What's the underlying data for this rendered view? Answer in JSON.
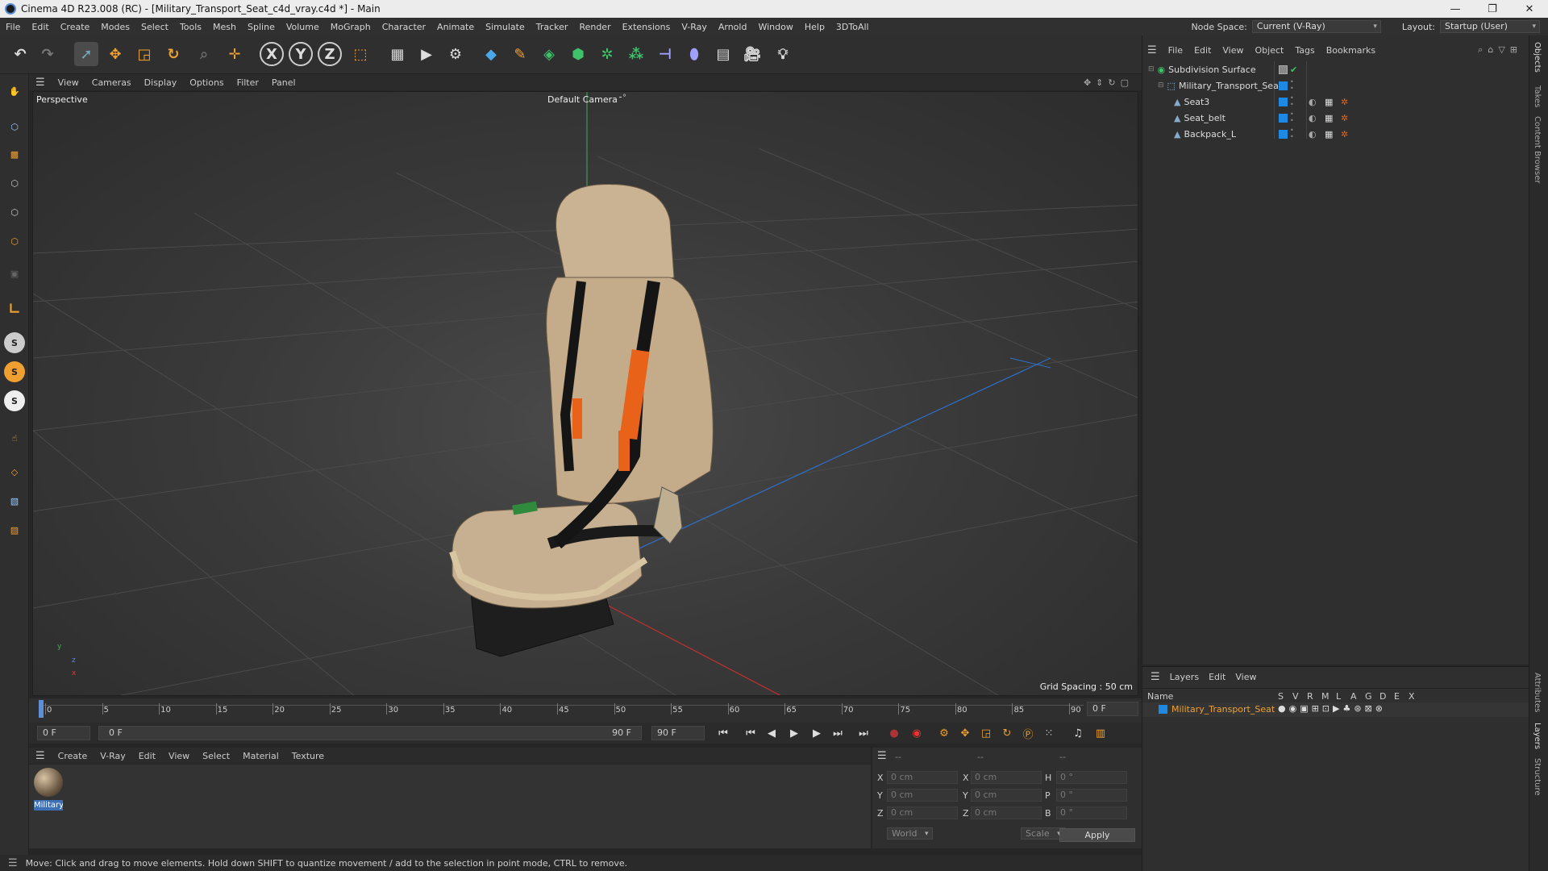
{
  "window": {
    "title": "Cinema 4D R23.008 (RC) - [Military_Transport_Seat_c4d_vray.c4d *] - Main",
    "min": "—",
    "max": "❐",
    "close": "✕"
  },
  "menu": [
    "File",
    "Edit",
    "Create",
    "Modes",
    "Select",
    "Tools",
    "Mesh",
    "Spline",
    "Volume",
    "MoGraph",
    "Character",
    "Animate",
    "Simulate",
    "Tracker",
    "Render",
    "Extensions",
    "V-Ray",
    "Arnold",
    "Window",
    "Help",
    "3DToAll"
  ],
  "node_space": {
    "label": "Node Space:",
    "value": "Current (V-Ray)"
  },
  "layout": {
    "label": "Layout:",
    "value": "Startup (User)"
  },
  "viewport": {
    "menu": [
      "View",
      "Cameras",
      "Display",
      "Options",
      "Filter",
      "Panel"
    ],
    "name": "Perspective",
    "camera": "Default Camera",
    "grid_spacing": "Grid Spacing : 50 cm",
    "axis": {
      "y": "y",
      "z": "z",
      "x": "x"
    }
  },
  "timeline": {
    "ticks": [
      "0",
      "5",
      "10",
      "15",
      "20",
      "25",
      "30",
      "35",
      "40",
      "45",
      "50",
      "55",
      "60",
      "65",
      "70",
      "75",
      "80",
      "85",
      "90"
    ],
    "current_frame": "0 F",
    "start": "0 F",
    "range_start": "0 F",
    "range_end": "90 F",
    "end": "90 F"
  },
  "material_manager": {
    "menu": [
      "Create",
      "V-Ray",
      "Edit",
      "View",
      "Select",
      "Material",
      "Texture"
    ],
    "materials": [
      {
        "name": "Military"
      }
    ]
  },
  "coordinates": {
    "header": [
      "--",
      "--",
      "--"
    ],
    "rows": [
      {
        "a": "X",
        "av": "0 cm",
        "b": "X",
        "bv": "0 cm",
        "c": "H",
        "cv": "0 °"
      },
      {
        "a": "Y",
        "av": "0 cm",
        "b": "Y",
        "bv": "0 cm",
        "c": "P",
        "cv": "0 °"
      },
      {
        "a": "Z",
        "av": "0 cm",
        "b": "Z",
        "bv": "0 cm",
        "c": "B",
        "cv": "0 °"
      }
    ],
    "mode": "World",
    "scale": "Scale",
    "apply": "Apply"
  },
  "status": "Move: Click and drag to move elements. Hold down SHIFT to quantize movement / add to the selection in point mode, CTRL to remove.",
  "object_manager": {
    "menu": [
      "File",
      "Edit",
      "View",
      "Object",
      "Tags",
      "Bookmarks"
    ],
    "objects": [
      {
        "name": "Subdivision Surface",
        "level": 0
      },
      {
        "name": "Military_Transport_Seat",
        "level": 1
      },
      {
        "name": "Seat3",
        "level": 2
      },
      {
        "name": "Seat_belt",
        "level": 2
      },
      {
        "name": "Backpack_L",
        "level": 2
      }
    ]
  },
  "layer_manager": {
    "menu": [
      "Layers",
      "Edit",
      "View"
    ],
    "columns": {
      "name": "Name",
      "flags": [
        "S",
        "V",
        "R",
        "M",
        "L",
        "A",
        "G",
        "D",
        "E",
        "X"
      ]
    },
    "layers": [
      {
        "name": "Military_Transport_Seat",
        "color": "#1e88e5"
      }
    ]
  },
  "side_tabs": [
    "Objects",
    "Takes",
    "Content Browser",
    "Attributes",
    "Layers",
    "Structure"
  ],
  "colors": {
    "accent": "#1e88e5",
    "selected_text": "#f0a030"
  }
}
